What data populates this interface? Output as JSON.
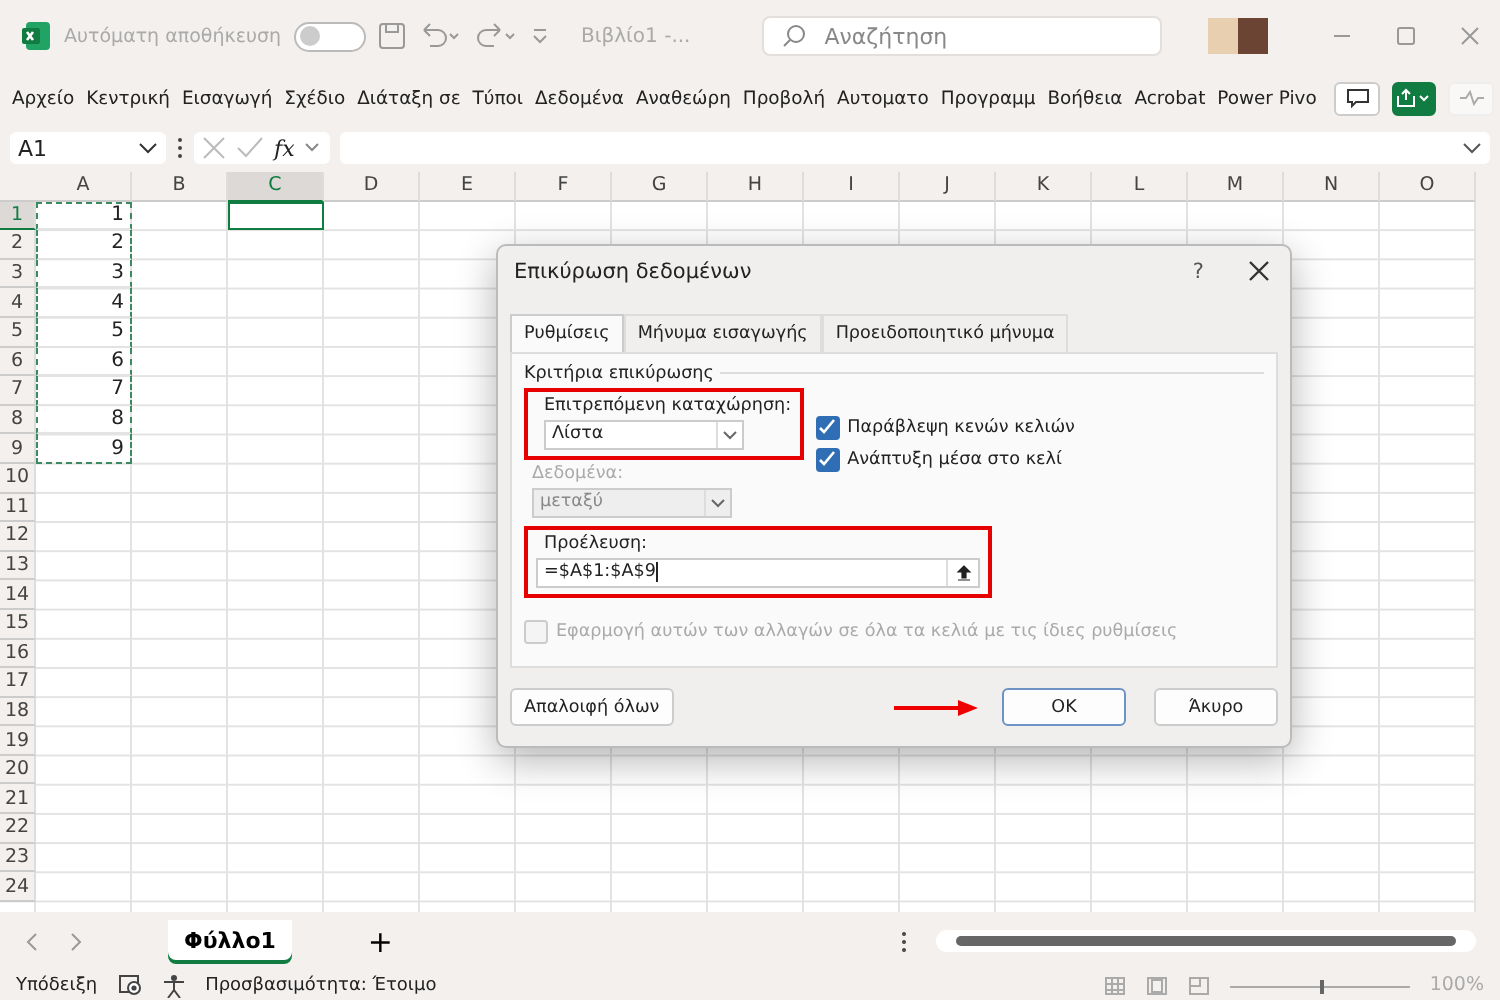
{
  "titlebar": {
    "autosave_label": "Αυτόματη αποθήκευση",
    "autosave_on": false,
    "filename": "Βιβλίο1 -...",
    "search_placeholder": "Αναζήτηση"
  },
  "ribbon_tabs": [
    "Αρχείο",
    "Κεντρική",
    "Εισαγωγή",
    "Σχέδιο",
    "Διάταξη σε",
    "Τύποι",
    "Δεδομένα",
    "Αναθεώρη",
    "Προβολή",
    "Αυτοματο",
    "Προγραμμ",
    "Βοήθεια",
    "Acrobat",
    "Power Pivo"
  ],
  "formula_bar": {
    "name_box": "A1",
    "fx": "fx"
  },
  "columns": [
    {
      "label": "A",
      "selected": false
    },
    {
      "label": "B",
      "selected": false
    },
    {
      "label": "C",
      "selected": true
    },
    {
      "label": "D",
      "selected": false
    },
    {
      "label": "E",
      "selected": false
    },
    {
      "label": "F",
      "selected": false
    },
    {
      "label": "G",
      "selected": false
    },
    {
      "label": "H",
      "selected": false
    },
    {
      "label": "I",
      "selected": false
    },
    {
      "label": "J",
      "selected": false
    },
    {
      "label": "K",
      "selected": false
    },
    {
      "label": "L",
      "selected": false
    },
    {
      "label": "M",
      "selected": false
    },
    {
      "label": "N",
      "selected": false
    },
    {
      "label": "O",
      "selected": false
    }
  ],
  "rows": [
    {
      "label": "1",
      "selected": true
    },
    {
      "label": "2",
      "selected": false
    },
    {
      "label": "3",
      "selected": false
    },
    {
      "label": "4",
      "selected": false
    },
    {
      "label": "5",
      "selected": false
    },
    {
      "label": "6",
      "selected": false
    },
    {
      "label": "7",
      "selected": false
    },
    {
      "label": "8",
      "selected": false
    },
    {
      "label": "9",
      "selected": false
    },
    {
      "label": "10",
      "selected": false
    },
    {
      "label": "11",
      "selected": false
    },
    {
      "label": "12",
      "selected": false
    },
    {
      "label": "13",
      "selected": false
    },
    {
      "label": "14",
      "selected": false
    },
    {
      "label": "15",
      "selected": false
    },
    {
      "label": "16",
      "selected": false
    },
    {
      "label": "17",
      "selected": false
    },
    {
      "label": "18",
      "selected": false
    },
    {
      "label": "19",
      "selected": false
    },
    {
      "label": "20",
      "selected": false
    },
    {
      "label": "21",
      "selected": false
    },
    {
      "label": "22",
      "selected": false
    },
    {
      "label": "23",
      "selected": false
    },
    {
      "label": "24",
      "selected": false
    }
  ],
  "column_a_values": [
    "1",
    "2",
    "3",
    "4",
    "5",
    "6",
    "7",
    "8",
    "9"
  ],
  "dialog": {
    "title": "Επικύρωση δεδομένων",
    "help": "?",
    "tabs": [
      {
        "label": "Ρυθμίσεις",
        "selected": true
      },
      {
        "label": "Μήνυμα εισαγωγής",
        "selected": false
      },
      {
        "label": "Προειδοποιητικό μήνυμα",
        "selected": false
      }
    ],
    "section": "Κριτήρια επικύρωσης",
    "allow_label": "Επιτρεπόμενη καταχώρηση:",
    "allow_value": "Λίστα",
    "options": [
      {
        "label": "Παράβλεψη κενών κελιών",
        "checked": true
      },
      {
        "label": "Ανάπτυξη μέσα στο κελί",
        "checked": true
      }
    ],
    "data_label": "Δεδομένα:",
    "data_value": "μεταξύ",
    "data_disabled": true,
    "source_label": "Προέλευση:",
    "source_value": "=$A$1:$A$9",
    "apply_all": {
      "label": "Εφαρμογή αυτών των αλλαγών σε όλα τα κελιά με τις ίδιες ρυθμίσεις",
      "checked": false,
      "disabled": true
    },
    "clear_button": "Απαλοιφή όλων",
    "ok_button": "OK",
    "cancel_button": "Άκυρο"
  },
  "sheet_tabs": [
    {
      "label": "Φύλλο1",
      "selected": true
    }
  ],
  "add_sheet": "+",
  "status_bar": {
    "hint": "Υπόδειξη",
    "accessibility": "Προσβασιμότητα: Έτοιμο",
    "zoom_slider": {
      "level": 0.5
    },
    "zoom": "100%"
  }
}
